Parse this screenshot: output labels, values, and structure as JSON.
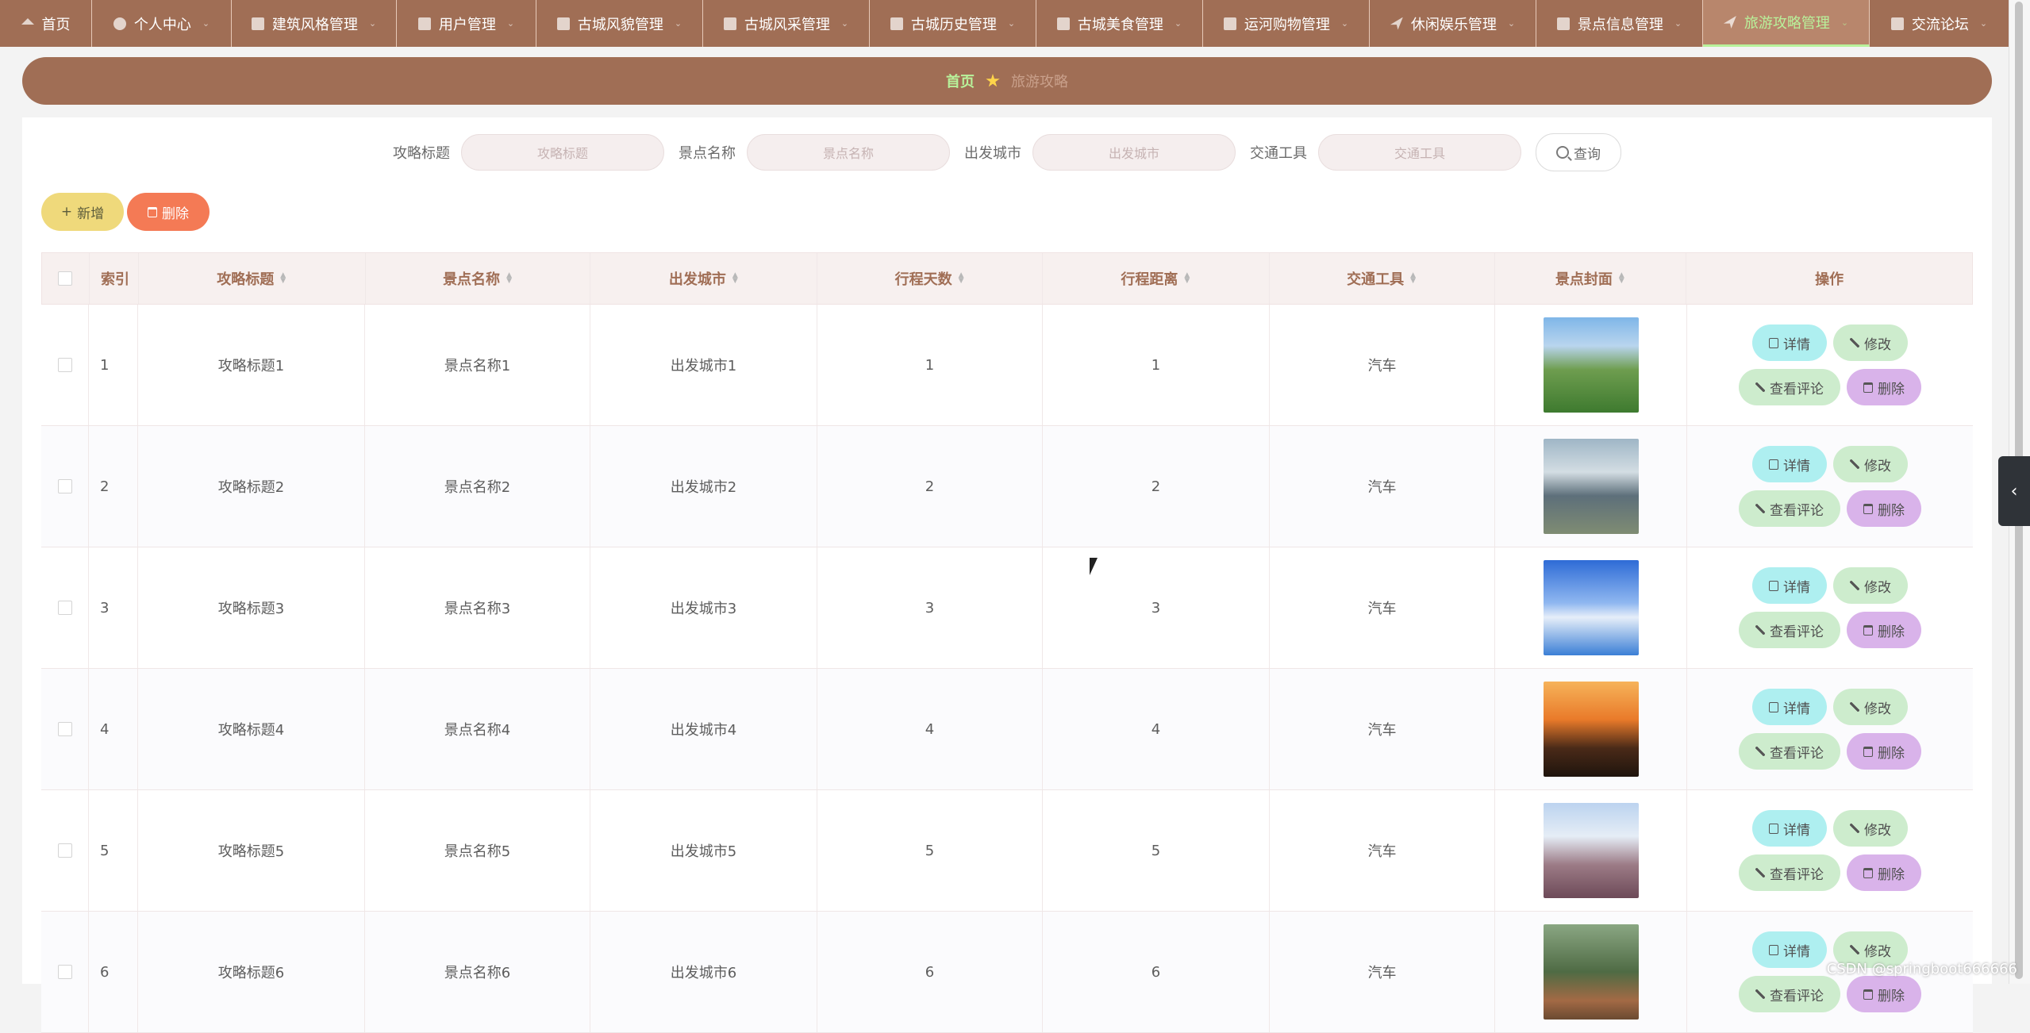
{
  "nav": {
    "items": [
      {
        "label": "首页",
        "width": 116
      },
      {
        "label": "个人中心",
        "width": 176
      },
      {
        "label": "建筑风格管理",
        "width": 208
      },
      {
        "label": "用户管理",
        "width": 176
      },
      {
        "label": "古城风貌管理",
        "width": 210
      },
      {
        "label": "古城风采管理",
        "width": 210
      },
      {
        "label": "古城历史管理",
        "width": 210
      },
      {
        "label": "古城美食管理",
        "width": 210
      },
      {
        "label": "运河购物管理",
        "width": 210
      },
      {
        "label": "休闲娱乐管理",
        "width": 210
      },
      {
        "label": "景点信息管理",
        "width": 210
      },
      {
        "label": "旅游攻略管理",
        "width": 210,
        "active": true
      },
      {
        "label": "交流论坛",
        "width": 176
      }
    ]
  },
  "breadcrumb": {
    "home": "首页",
    "current": "旅游攻略"
  },
  "search": {
    "title_label": "攻略标题",
    "title_placeholder": "攻略标题",
    "spot_label": "景点名称",
    "spot_placeholder": "景点名称",
    "city_label": "出发城市",
    "city_placeholder": "出发城市",
    "tool_label": "交通工具",
    "tool_placeholder": "交通工具",
    "query": "查询"
  },
  "actions": {
    "add": "新增",
    "delete": "删除"
  },
  "table": {
    "headers": {
      "index": "索引",
      "title": "攻略标题",
      "spot": "景点名称",
      "city": "出发城市",
      "days": "行程天数",
      "distance": "行程距离",
      "tool": "交通工具",
      "cover": "景点封面",
      "op": "操作"
    },
    "rows": [
      {
        "index": "1",
        "title": "攻略标题1",
        "spot": "景点名称1",
        "city": "出发城市1",
        "days": "1",
        "distance": "1",
        "tool": "汽车"
      },
      {
        "index": "2",
        "title": "攻略标题2",
        "spot": "景点名称2",
        "city": "出发城市2",
        "days": "2",
        "distance": "2",
        "tool": "汽车"
      },
      {
        "index": "3",
        "title": "攻略标题3",
        "spot": "景点名称3",
        "city": "出发城市3",
        "days": "3",
        "distance": "3",
        "tool": "汽车"
      },
      {
        "index": "4",
        "title": "攻略标题4",
        "spot": "景点名称4",
        "city": "出发城市4",
        "days": "4",
        "distance": "4",
        "tool": "汽车"
      },
      {
        "index": "5",
        "title": "攻略标题5",
        "spot": "景点名称5",
        "city": "出发城市5",
        "days": "5",
        "distance": "5",
        "tool": "汽车"
      },
      {
        "index": "6",
        "title": "攻略标题6",
        "spot": "景点名称6",
        "city": "出发城市6",
        "days": "6",
        "distance": "6",
        "tool": "汽车"
      }
    ],
    "row_buttons": {
      "detail": "详情",
      "edit": "修改",
      "comments": "查看评论",
      "delete": "删除"
    }
  },
  "watermark": "CSDN @springboot666666"
}
